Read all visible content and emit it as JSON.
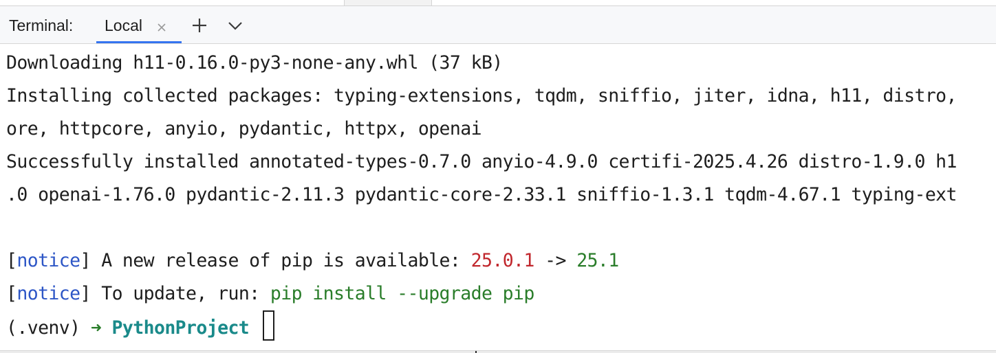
{
  "header": {
    "title": "Terminal:",
    "tabs": [
      {
        "label": "Local",
        "active": true
      }
    ],
    "buttons": {
      "new_tab_icon": "plus-icon",
      "more_tabs_icon": "chevron-down-icon",
      "close_tab_icon": "close-icon"
    }
  },
  "terminal": {
    "lines": {
      "l1": "Downloading h11-0.16.0-py3-none-any.whl (37 kB)",
      "l2": "Installing collected packages: typing-extensions, tqdm, sniffio, jiter, idna, h11, distro,",
      "l3": "ore, httpcore, anyio, pydantic, httpx, openai",
      "l4": "Successfully installed annotated-types-0.7.0 anyio-4.9.0 certifi-2025.4.26 distro-1.9.0 h1",
      "l5": ".0 openai-1.76.0 pydantic-2.11.3 pydantic-core-2.33.1 sniffio-1.3.1 tqdm-4.67.1 typing-ext"
    },
    "notice1": {
      "open_bracket": "[",
      "tag": "notice",
      "close_bracket": "]",
      "text": " A new release of pip is available: ",
      "old_version": "25.0.1",
      "arrow": " -> ",
      "new_version": "25.1"
    },
    "notice2": {
      "open_bracket": "[",
      "tag": "notice",
      "close_bracket": "]",
      "text": " To update, run: ",
      "command": "pip install --upgrade pip"
    },
    "prompt": {
      "venv": "(.venv) ",
      "arrow": "➜",
      "directory": " PythonProject "
    }
  },
  "colors": {
    "accent_tab_underline": "#3574f0",
    "notice_blue": "#2d56c6",
    "old_version_red": "#c1272d",
    "new_version_green": "#2a7d2a",
    "prompt_dir_teal": "#1a8a8a"
  }
}
